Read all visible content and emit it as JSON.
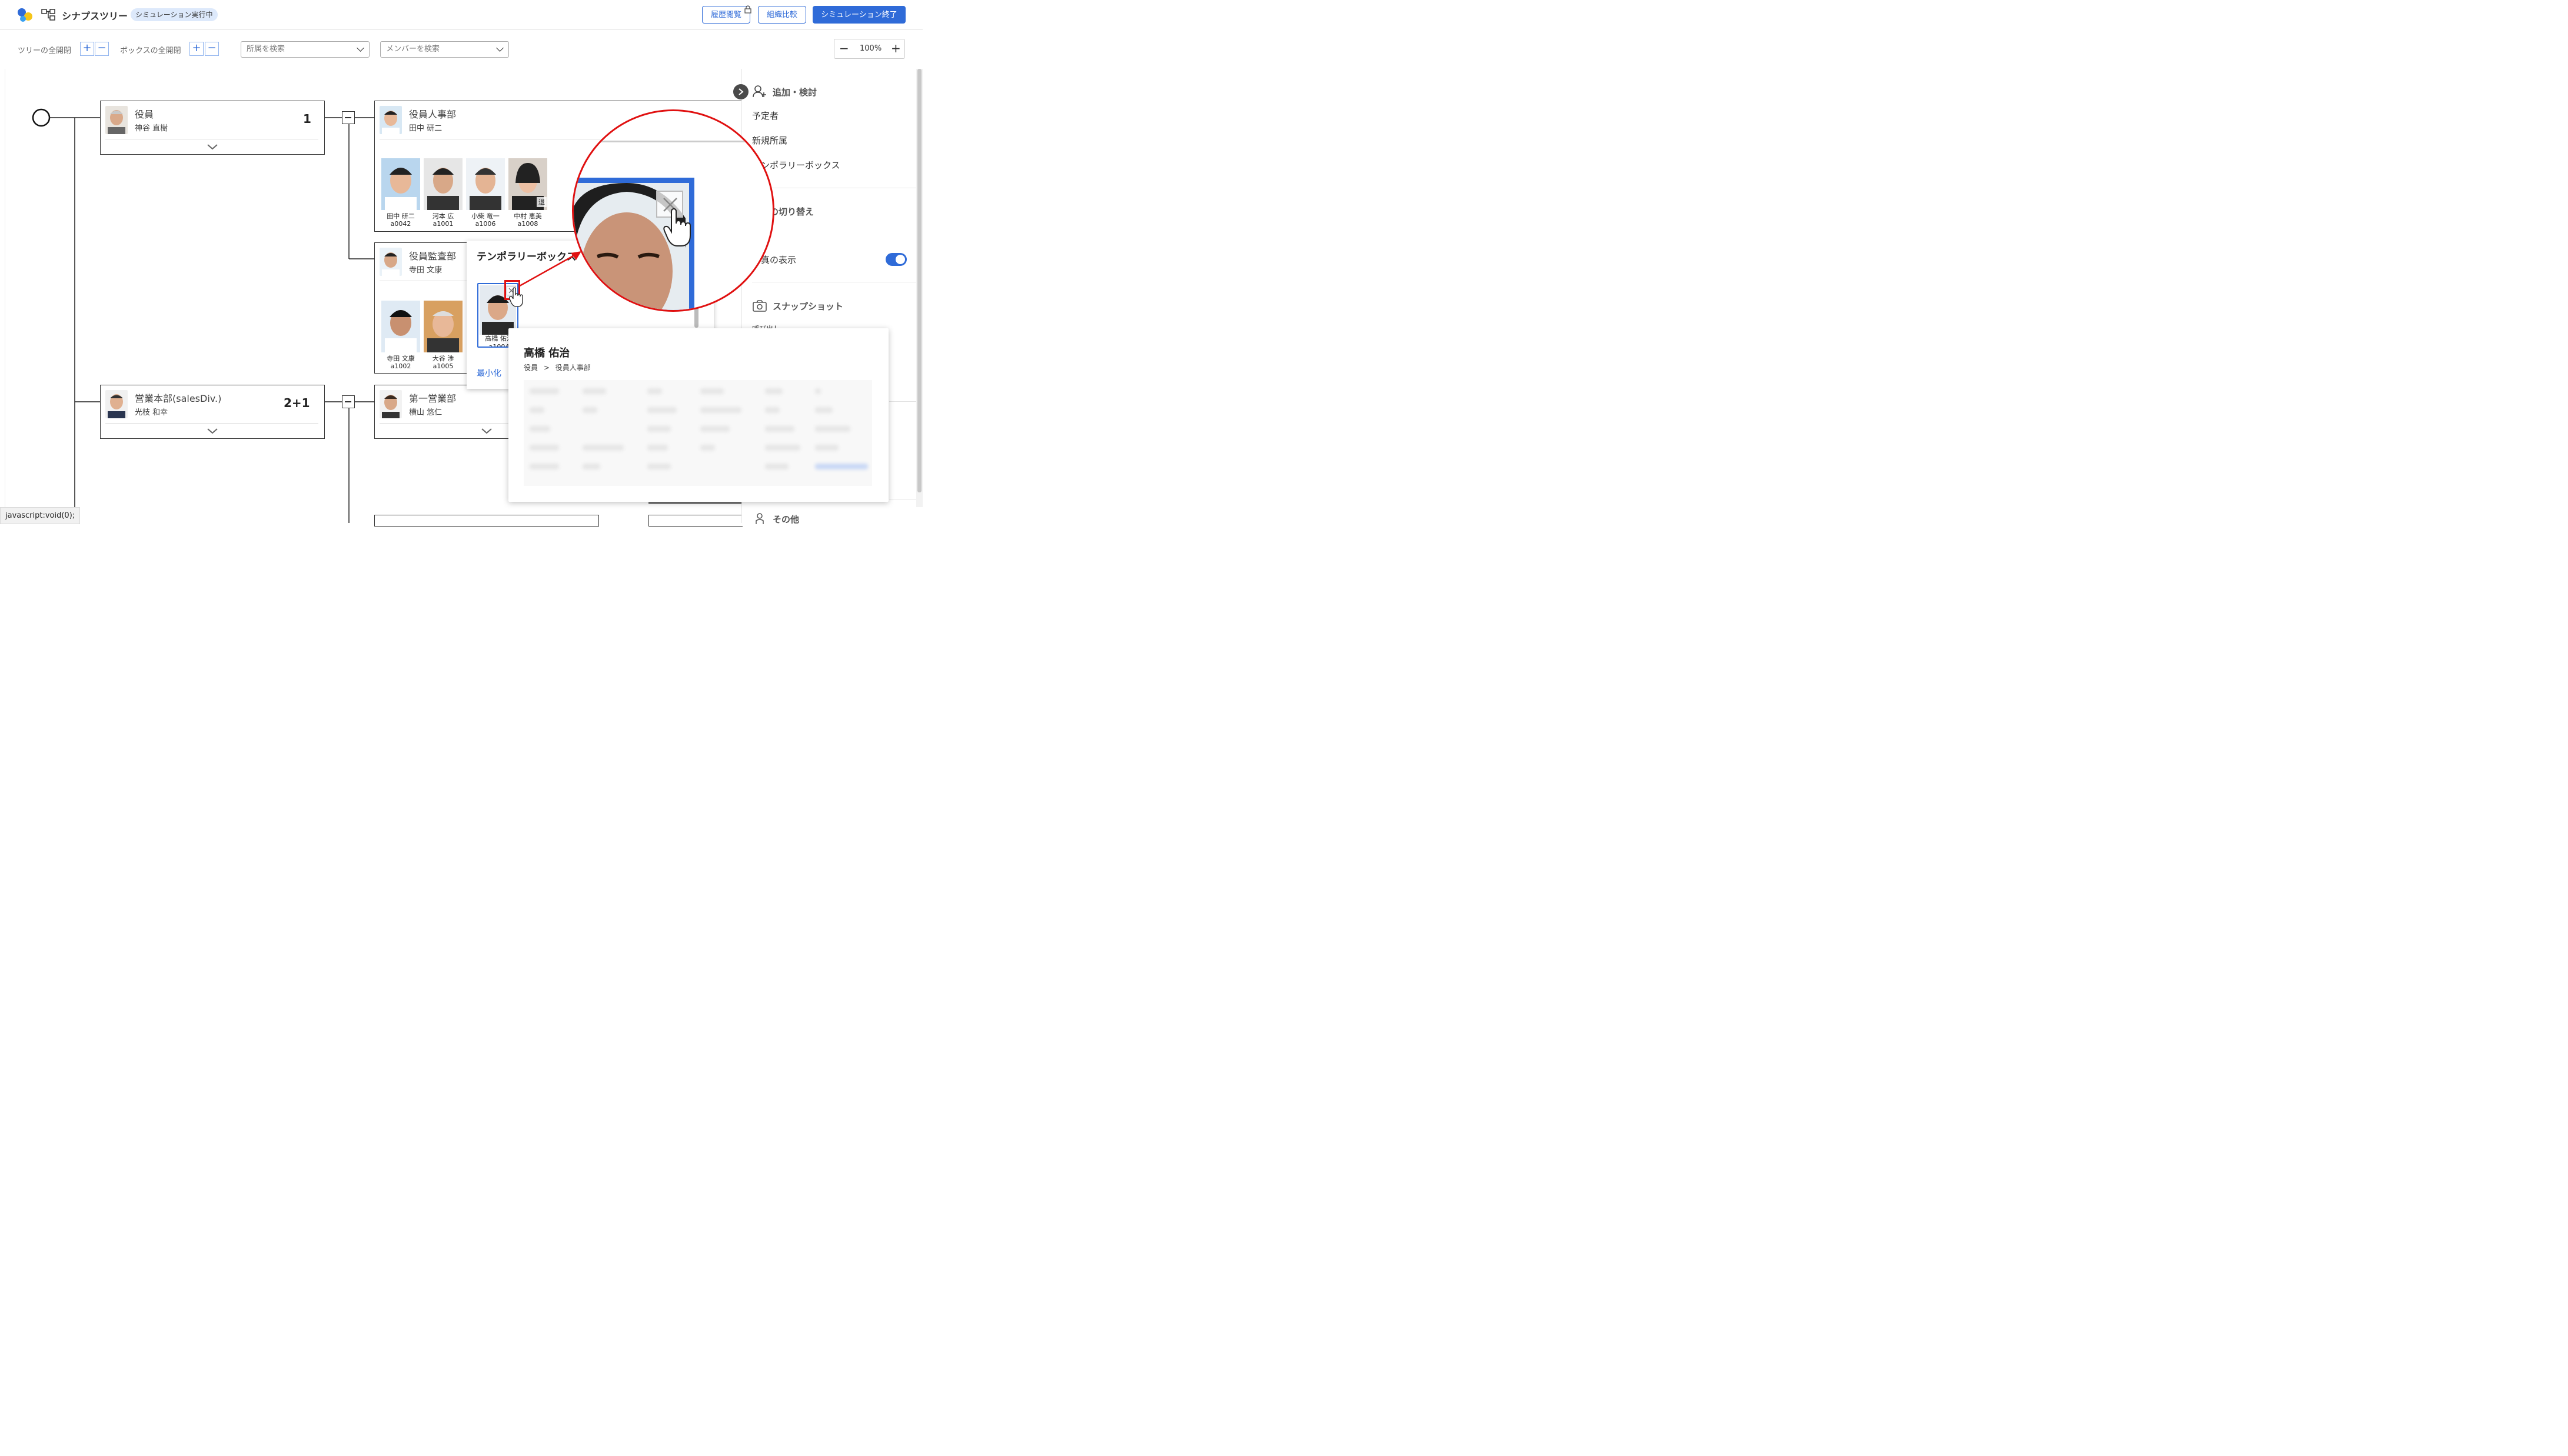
{
  "header": {
    "app_title": "シナプスツリー",
    "sim_badge": "シミュレーション実行中",
    "history_btn": "履歴閲覧",
    "compare_btn": "組織比較",
    "end_sim_btn": "シミュレーション終了"
  },
  "toolbar": {
    "tree_toggle_label": "ツリーの全開閉",
    "box_toggle_label": "ボックスの全開閉",
    "dept_search_placeholder": "所属を検索",
    "member_search_placeholder": "メンバーを検索",
    "zoom_level": "100%"
  },
  "tree": {
    "root_boxes": [
      {
        "name": "役員",
        "person": "神谷 直樹",
        "count": "1"
      },
      {
        "name": "営業本部(salesDiv.)",
        "person": "光枝 和幸",
        "count": "2+1"
      }
    ],
    "child_boxes": [
      {
        "name": "役員人事部",
        "person": "田中 研二",
        "members": [
          {
            "name": "田中 研二",
            "id": "a0042"
          },
          {
            "name": "河本 広",
            "id": "a1001"
          },
          {
            "name": "小柴 竜一",
            "id": "a1006"
          },
          {
            "name": "中村 恵美",
            "id": "a1008",
            "badge": "退"
          }
        ]
      },
      {
        "name": "役員監査部",
        "person": "寺田 文康",
        "members": [
          {
            "name": "寺田 文康",
            "id": "a1002"
          },
          {
            "name": "大谷 渉",
            "id": "a1005"
          }
        ]
      },
      {
        "name": "第一営業部",
        "person": "横山 悠仁"
      }
    ]
  },
  "temp_box": {
    "title": "テンポラリーボックス",
    "member": {
      "name": "高橋 佑治",
      "id": "a1004"
    },
    "minimize_label": "最小化"
  },
  "popup": {
    "name": "高橋 佑治",
    "path": [
      "役員",
      "役員人事部"
    ],
    "path_sep": ">"
  },
  "right_panel": {
    "add_section": "追加・検討",
    "items": [
      "予定者",
      "新規所属",
      "テンポラリーボックス"
    ],
    "display_section": "表示の切り替え",
    "display_sub": "ル",
    "photo_toggle_label": "写真の表示",
    "snapshot_section": "スナップショット",
    "snapshot_partial": "呼び出し",
    "other_section": "その他"
  },
  "statusbar": {
    "text": "javascript:void(0);"
  },
  "colors": {
    "accent": "#2f6bd8",
    "highlight_red": "#e01010",
    "badge_bg": "#dde9fb"
  }
}
